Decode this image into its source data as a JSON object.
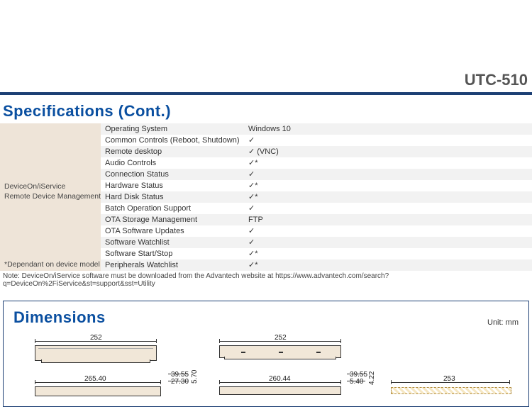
{
  "model": "UTC-510",
  "specs_title": "Specifications (Cont.)",
  "group": {
    "name_line1": "DeviceOn/iService",
    "name_line2": "Remote Device Management",
    "footnote_in_cell": "*Dependant on device model"
  },
  "rows": [
    {
      "label": "Operating System",
      "value": "Windows 10"
    },
    {
      "label": "Common Controls (Reboot, Shutdown)",
      "value": "✓"
    },
    {
      "label": "Remote desktop",
      "value": "✓ (VNC)"
    },
    {
      "label": "Audio Controls",
      "value": "✓*"
    },
    {
      "label": "Connection Status",
      "value": "✓"
    },
    {
      "label": "Hardware Status",
      "value": "✓*"
    },
    {
      "label": "Hard Disk Status",
      "value": "✓*"
    },
    {
      "label": "Batch Operation Support",
      "value": "✓"
    },
    {
      "label": "OTA Storage Management",
      "value": "FTP"
    },
    {
      "label": "OTA Software Updates",
      "value": "✓"
    },
    {
      "label": "Software Watchlist",
      "value": "✓"
    },
    {
      "label": "Software Start/Stop",
      "value": "✓*"
    },
    {
      "label": "Peripherals Watchlist",
      "value": "✓*"
    }
  ],
  "note": "Note: DeviceOn/iService software must be downloaded from the Advantech website at https://www.advantech.com/search?q=DeviceOn%2FiService&st=support&sst=Utility",
  "dimensions": {
    "title": "Dimensions",
    "unit": "Unit: mm",
    "values": {
      "top_left_w": "252",
      "top_right_w": "252",
      "bottom_left_w": "265.40",
      "bottom_left_small1": "39.55",
      "bottom_left_small2": "27.30",
      "bottom_left_small3": "5.70",
      "bottom_mid_w": "260.44",
      "bottom_mid_small1": "39.55",
      "bottom_mid_small2": "5.40",
      "bottom_mid_small3": "4.22",
      "bottom_right_w": "253"
    }
  }
}
